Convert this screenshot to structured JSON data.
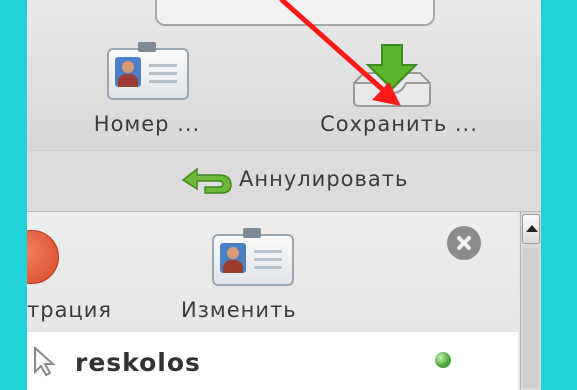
{
  "toolbar": {
    "number_label": "Номер ...",
    "save_label": "Сохранить ..."
  },
  "undo": {
    "label": "Аннулировать"
  },
  "contact_panel": {
    "register_label": "трация",
    "edit_label": "Изменить"
  },
  "list": {
    "items": [
      {
        "name": "reskolos",
        "status": "online",
        "status_color": "#45a535"
      }
    ]
  },
  "icons": [
    "contact-card-icon",
    "save-download-icon",
    "undo-arrow-icon",
    "close-icon",
    "cursor-icon",
    "status-dot-icon"
  ],
  "annotation": {
    "arrow_color": "#ff1a1a"
  }
}
